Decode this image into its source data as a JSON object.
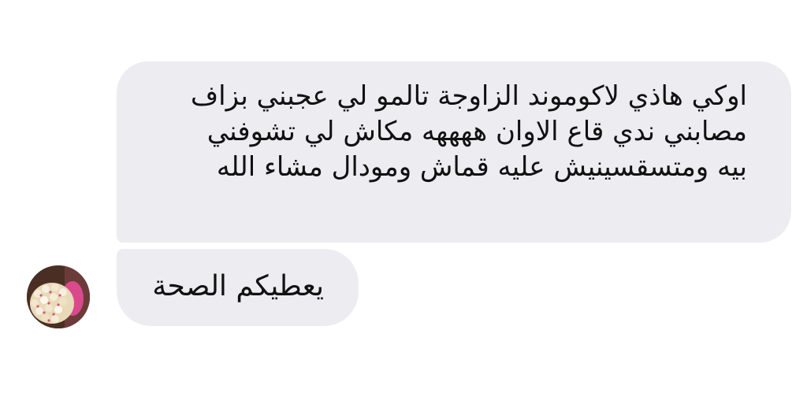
{
  "conversation": {
    "messages": [
      {
        "lines": [
          "اوكي هاذي لاكوموند الزاوجة  تالمو لي عجبني بزاف",
          "مصابني ندي قاع الاوان ههههه مكاش لي تشوفني",
          "بيه ومتسقسينيش عليه قماش ومودال مشاء الله"
        ]
      },
      {
        "lines": [
          "يعطيكم الصحة"
        ]
      }
    ],
    "sender_avatar": {
      "icon": "flower-bouquet-photo"
    },
    "colors": {
      "bubble_background": "#ececf1",
      "text": "#111111",
      "page_background": "#ffffff"
    }
  }
}
